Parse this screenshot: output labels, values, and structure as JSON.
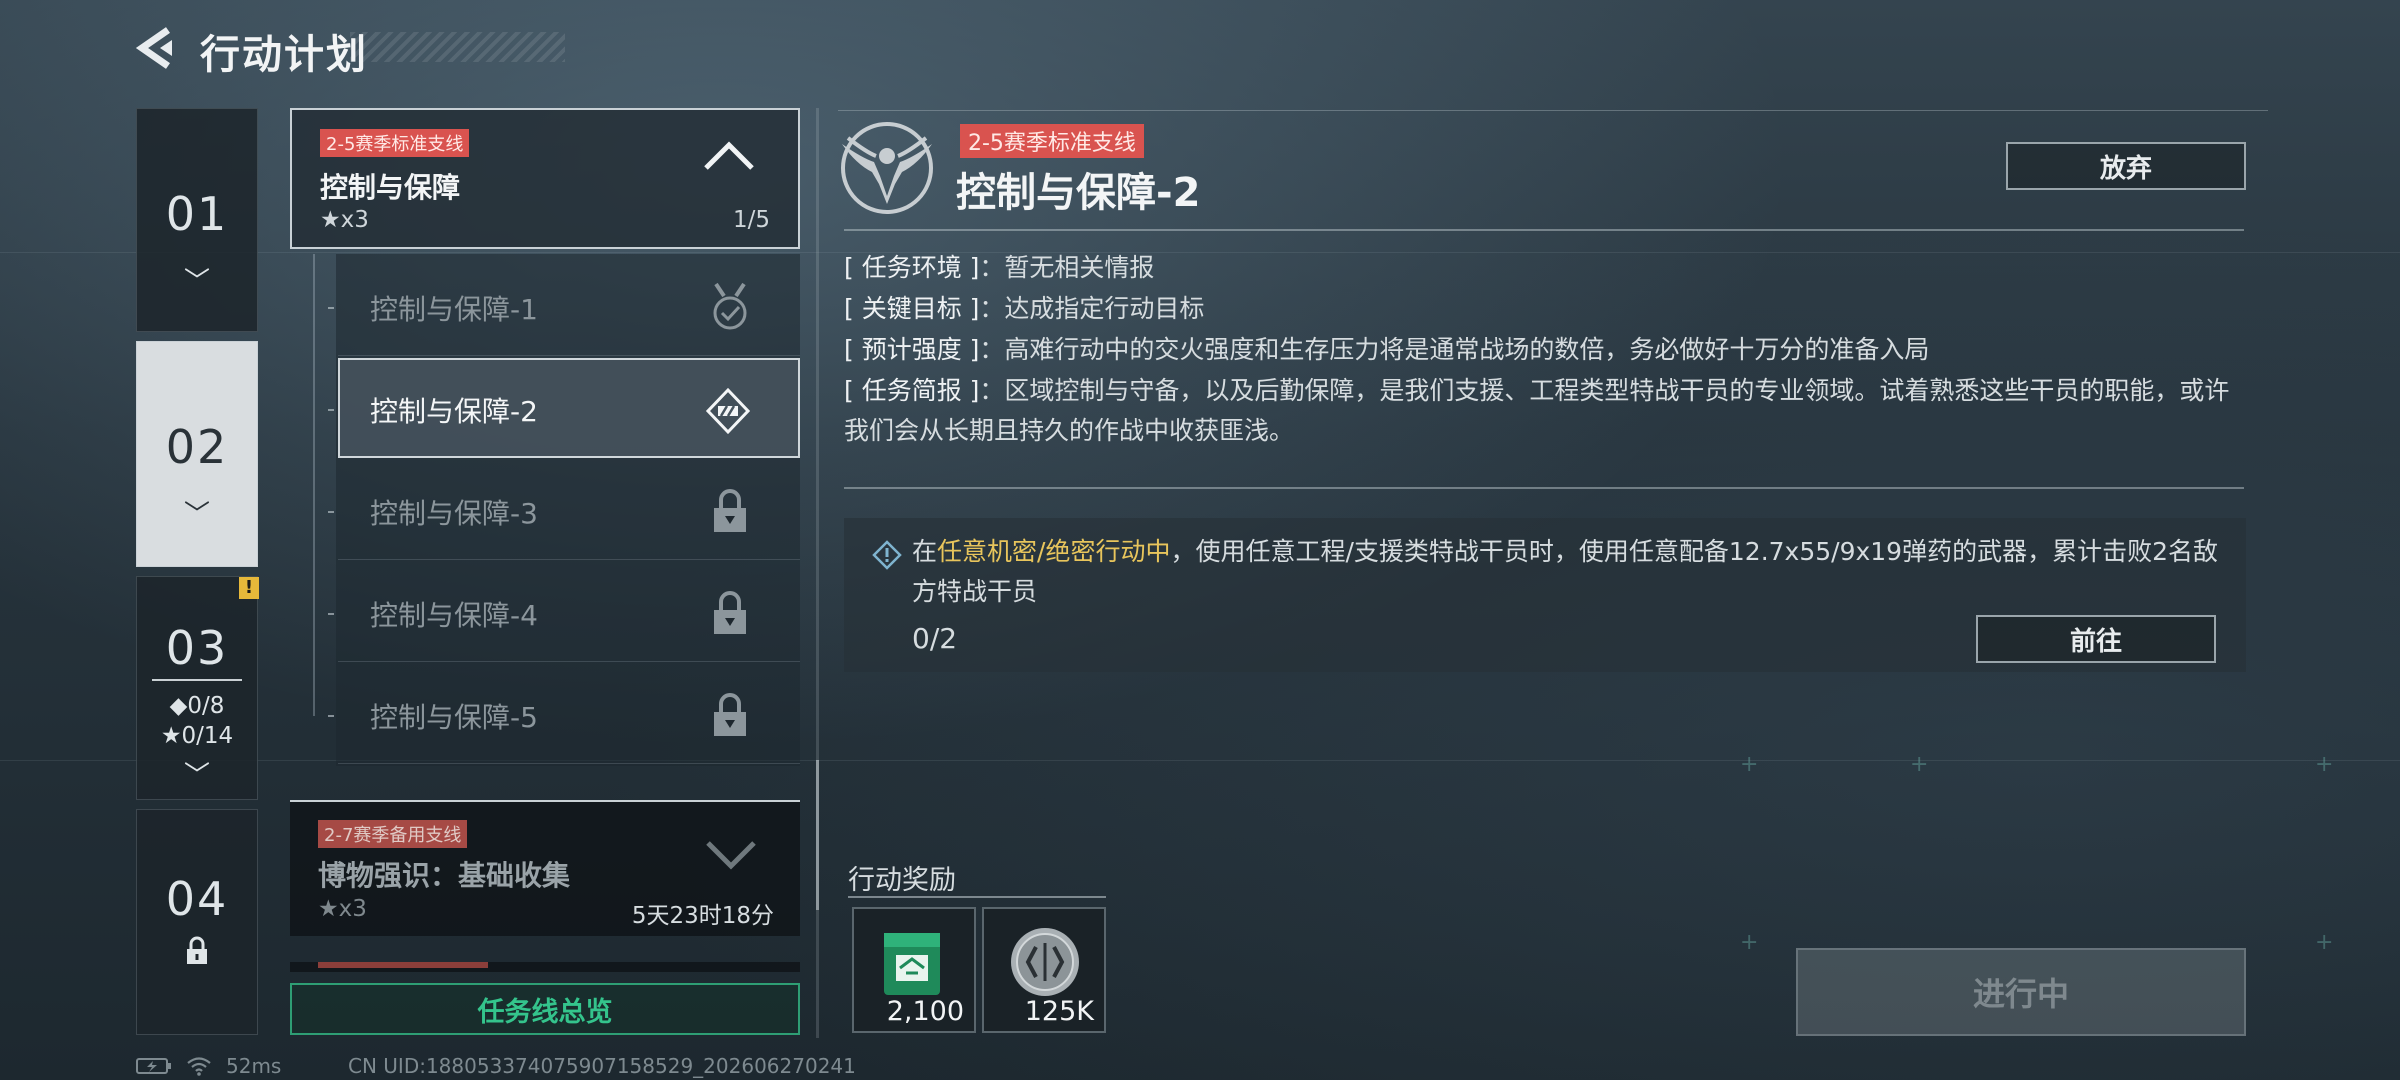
{
  "header": {
    "title": "行动计划"
  },
  "chapters": [
    {
      "num": "01"
    },
    {
      "num": "02"
    },
    {
      "num": "03",
      "stat_diamond": "◆0/8",
      "stat_star": "★0/14",
      "badge": "!"
    },
    {
      "num": "04"
    }
  ],
  "mission_line": {
    "tag": "2-5赛季标准支线",
    "name": "控制与保障",
    "stars": "★x3",
    "progress": "1/5",
    "items": [
      {
        "label": "控制与保障-1",
        "status": "completed"
      },
      {
        "label": "控制与保障-2",
        "status": "in-progress"
      },
      {
        "label": "控制与保障-3",
        "status": "locked"
      },
      {
        "label": "控制与保障-4",
        "status": "locked"
      },
      {
        "label": "控制与保障-5",
        "status": "locked"
      }
    ]
  },
  "mission_line2": {
    "tag": "2-7赛季备用支线",
    "name": "博物强识：基础收集",
    "stars": "★x3",
    "time_left": "5天23时18分"
  },
  "overview_button": "任务线总览",
  "detail": {
    "tag": "2-5赛季标准支线",
    "title": "控制与保障-2",
    "abandon_label": "放弃",
    "env_key": "[ 任务环境 ]",
    "env_val": "：暂无相关情报",
    "goal_key": "[ 关键目标 ]",
    "goal_val": "：达成指定行动目标",
    "intensity_key": "[ 预计强度 ]",
    "intensity_val": "：高难行动中的交火强度和生存压力将是通常战场的数倍，务必做好十万分的准备入局",
    "brief_key": "[ 任务简报 ]",
    "brief_val": "：区域控制与守备，以及后勤保障，是我们支援、工程类型特战干员的专业领域。试着熟悉这些干员的职能，或许我们会从长期且持久的作战中收获匪浅。"
  },
  "task": {
    "prefix": "在",
    "highlight": "任意机密/绝密行动中",
    "text": "，使用任意工程/支援类特战干员时，使用任意配备12.7x55/9x19弹药的武器，累计击败2名敌方特战干员",
    "count": "0/2",
    "goto_label": "前往"
  },
  "rewards": {
    "title": "行动奖励",
    "items": [
      {
        "icon": "supply-crate-icon",
        "amount": "2,100"
      },
      {
        "icon": "silver-coin-icon",
        "amount": "125K"
      }
    ]
  },
  "progress_button": "进行中",
  "status_bar": {
    "ping": "52ms",
    "uid": "CN UID:18805337407590715852​9_202606270241"
  },
  "colors": {
    "tag_red": "#d9534f",
    "accent_green": "#34c48c",
    "highlight_yellow": "#e8c55c"
  }
}
